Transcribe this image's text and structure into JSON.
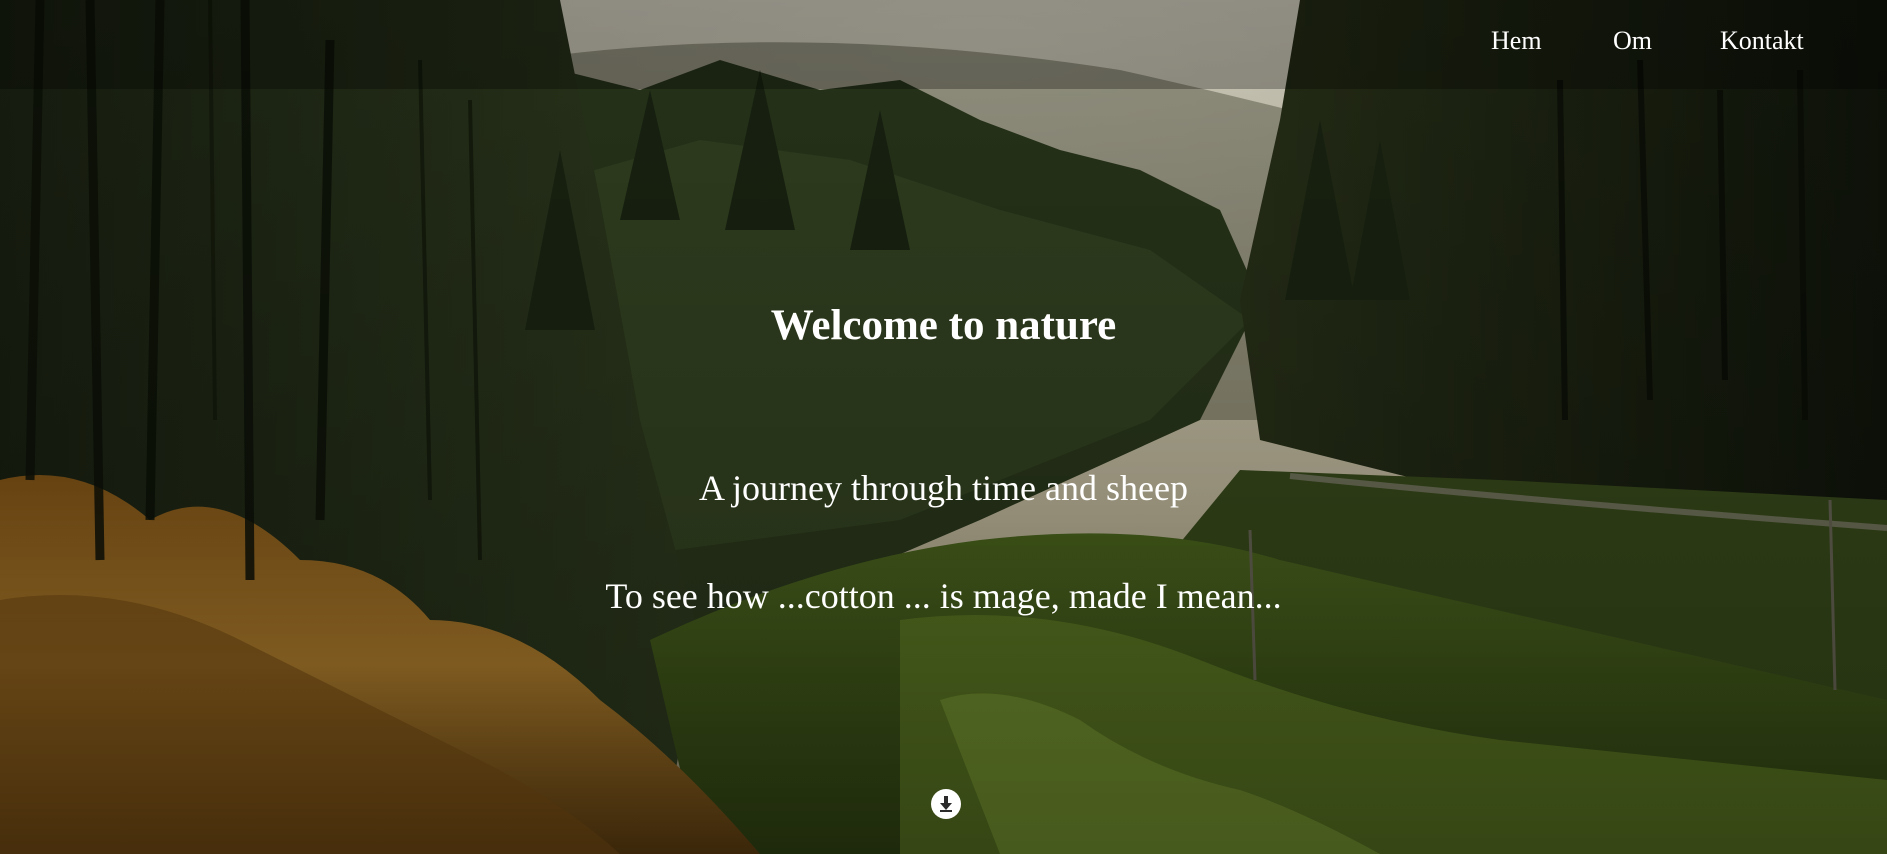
{
  "nav": {
    "items": [
      {
        "label": "Hem"
      },
      {
        "label": "Om"
      },
      {
        "label": "Kontakt"
      }
    ]
  },
  "hero": {
    "title": "Welcome to nature",
    "subtitle": "A journey through time and sheep",
    "tagline": "To see how ...cotton ... is mage, made I mean...",
    "background_icon": "forest-valley-photo",
    "scroll_icon": "arrow-down-circle-icon"
  },
  "colors": {
    "text": "#ffffff",
    "nav_overlay": "rgba(0,0,0,0.28)",
    "forest_dark": "#1d2516",
    "meadow_green": "#5f7a26",
    "autumn_orange": "#b07a2a",
    "sky_haze": "#d8d3c2"
  }
}
